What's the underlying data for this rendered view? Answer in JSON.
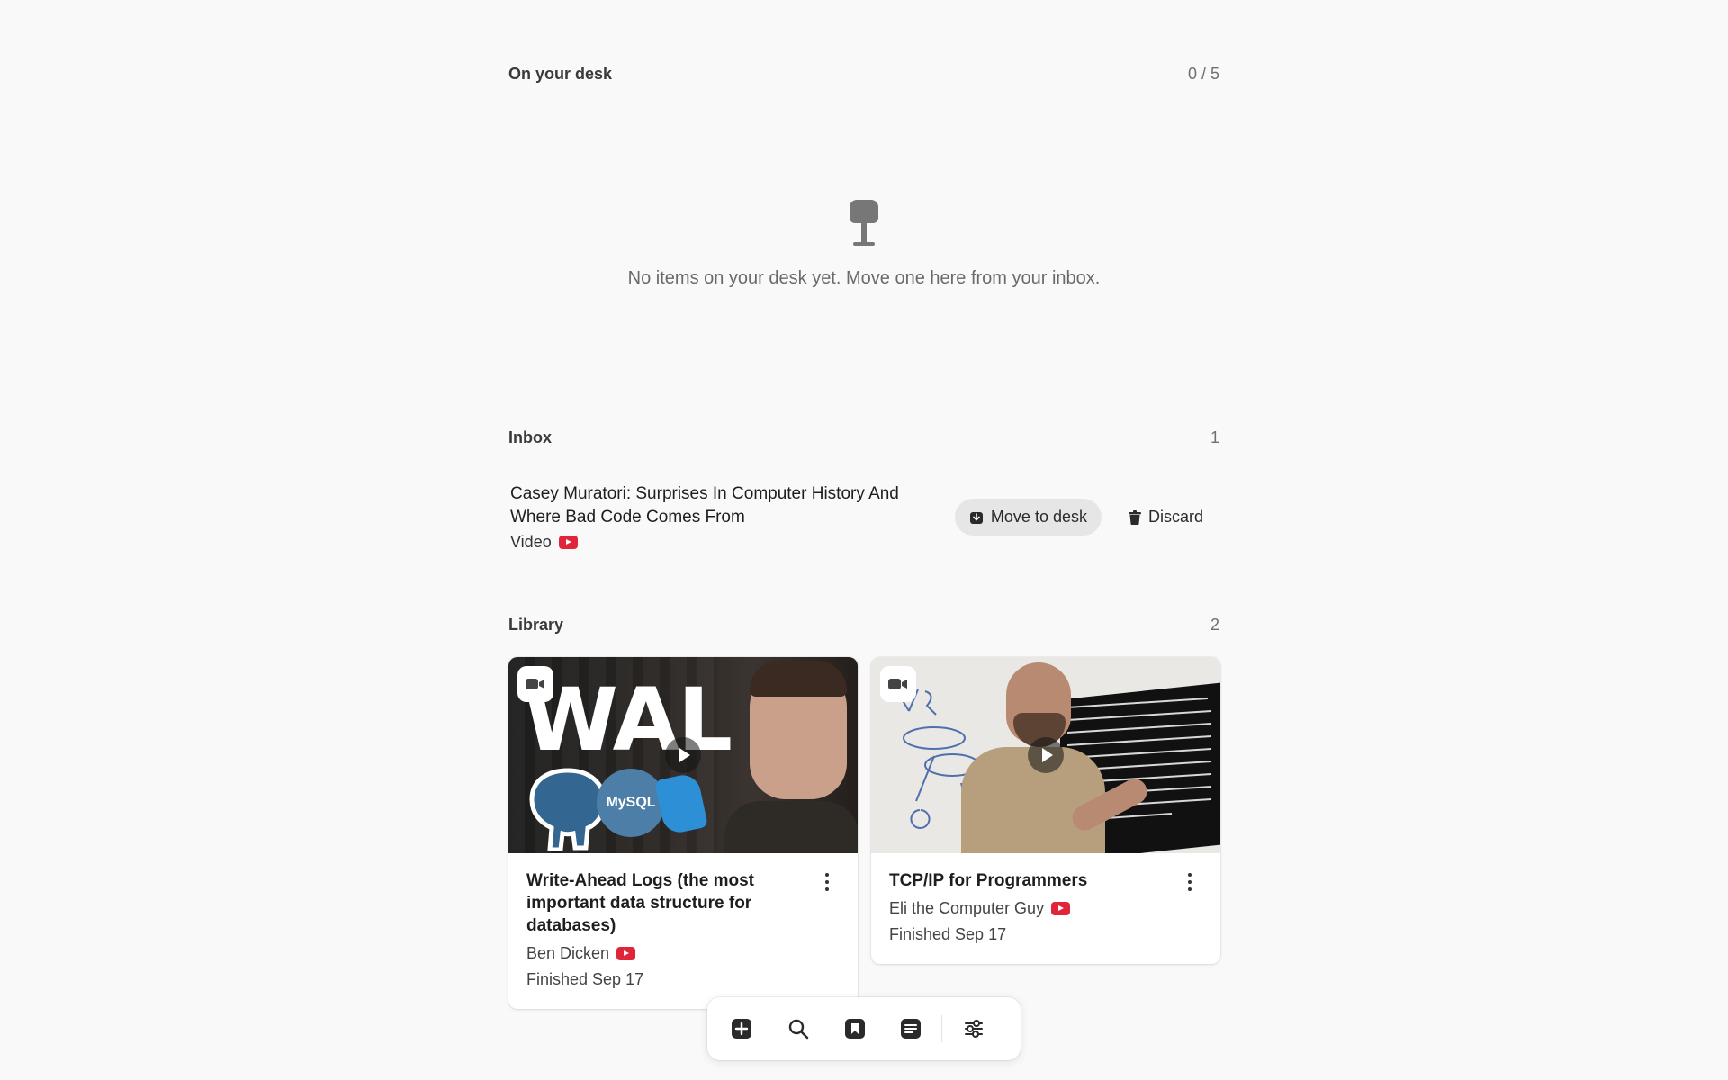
{
  "desk": {
    "title": "On your desk",
    "count": "0 / 5",
    "empty_icon": "desk-lamp-icon",
    "empty_message": "No items on your desk yet. Move one here from your inbox."
  },
  "inbox": {
    "title": "Inbox",
    "count": "1",
    "items": [
      {
        "title": "Casey Muratori: Surprises In Computer History And Where Bad Code Comes From",
        "type": "Video",
        "source_icon": "youtube-icon",
        "move_label": "Move to desk",
        "discard_label": "Discard"
      }
    ]
  },
  "library": {
    "title": "Library",
    "count": "2",
    "cards": [
      {
        "title": "Write-Ahead Logs (the most important data structure for databases)",
        "author": "Ben Dicken",
        "status": "Finished Sep 17",
        "thumb_text": "WAL",
        "thumb_logo": "MySQL"
      },
      {
        "title": "TCP/IP for Programmers",
        "author": "Eli the Computer Guy",
        "status": "Finished Sep 17"
      }
    ]
  },
  "toolbar": {
    "items": [
      "add-icon",
      "search-icon",
      "bookmark-icon",
      "notes-icon",
      "sliders-icon"
    ]
  },
  "colors": {
    "background": "#f9f9f9",
    "youtube_red": "#e0243a",
    "primary_button_bg": "#e6e6e6"
  }
}
